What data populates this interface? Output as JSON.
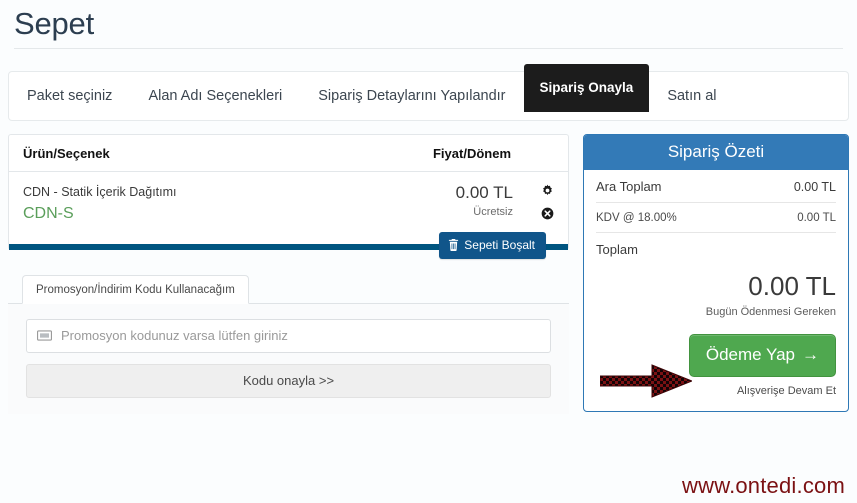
{
  "page": {
    "title": "Sepet",
    "watermark": "www.ontedi.com"
  },
  "tabs": [
    {
      "label": "Paket seçiniz",
      "active": false
    },
    {
      "label": "Alan Adı Seçenekleri",
      "active": false
    },
    {
      "label": "Sipariş Detaylarını Yapılandır",
      "active": false
    },
    {
      "label": "Sipariş Onayla",
      "active": true
    },
    {
      "label": "Satın al",
      "active": false
    }
  ],
  "cart": {
    "headers": {
      "product": "Ürün/Seçenek",
      "price": "Fiyat/Dönem"
    },
    "items": [
      {
        "name": "CDN - Statik İçerik Dağıtımı",
        "option": "CDN-S",
        "price": "0.00 TL",
        "price_note": "Ücretsiz",
        "config_icon": "gear-icon",
        "remove_icon": "remove-circle-icon"
      }
    ],
    "empty_button": {
      "label": "Sepeti Boşalt",
      "icon": "trash-icon"
    }
  },
  "promo": {
    "tab_label": "Promosyon/İndirim Kodu Kullanacağım",
    "input_icon": "ticket-icon",
    "placeholder": "Promosyon kodunuz varsa lütfen giriniz",
    "input_value": "",
    "confirm_label": "Kodu onayla >>"
  },
  "summary": {
    "title": "Sipariş Özeti",
    "rows": [
      {
        "label": "Ara Toplam",
        "value": "0.00 TL",
        "size": "normal"
      },
      {
        "label": "KDV @ 18.00%",
        "value": "0.00 TL",
        "size": "small"
      },
      {
        "label": "Toplam",
        "value": "",
        "size": "normal"
      }
    ],
    "total_amount": "0.00 TL",
    "total_caption": "Bugün Ödenmesi Gereken",
    "pay_button": "Ödeme Yap",
    "pay_button_arrow": "→",
    "continue_link": "Alışverişe Devam Et"
  },
  "colors": {
    "summary_header": "#337ab7",
    "pay_button": "#4fa84f",
    "active_tab": "#1c1c1c",
    "cart_footer_bar": "#005580",
    "empty_cart_button": "#10558a",
    "option_text": "#5a9e5a",
    "annotation_arrow": "#7b1113",
    "watermark": "#7b1113"
  }
}
